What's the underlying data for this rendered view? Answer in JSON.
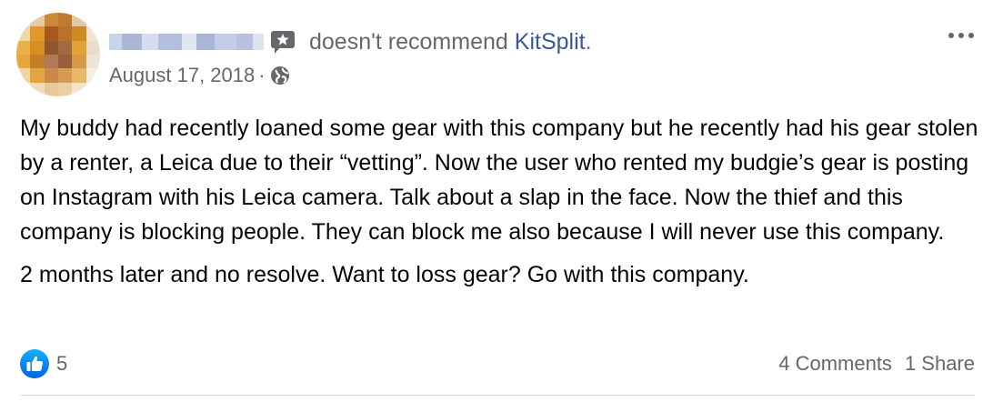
{
  "post": {
    "action_text": "doesn't recommend",
    "page_name": "KitSplit",
    "end_punct": ".",
    "date": "August 17, 2018",
    "date_sep": "·",
    "paragraphs": [
      "My buddy had recently loaned some gear with this company but he recently had his gear stolen by a renter, a Leica due to their “vetting”. Now the user who rented my budgie’s gear is posting on Instagram with his Leica camera. Talk about a slap in the face. Now the thief and this company is blocking people. They can block me also because I will never use this company.",
      "2 months later and no resolve. Want to loss gear? Go with this company."
    ],
    "reaction_count": "5",
    "comments": "4 Comments",
    "shares": "1 Share"
  },
  "icons": {
    "recommend": "star-speech-bubble-icon",
    "privacy": "globe-icon",
    "more": "more-horizontal-icon",
    "like": "like-thumb-icon"
  },
  "colors": {
    "link": "#385898",
    "meta_text": "#65676b",
    "like_blue": "#1877f2"
  }
}
